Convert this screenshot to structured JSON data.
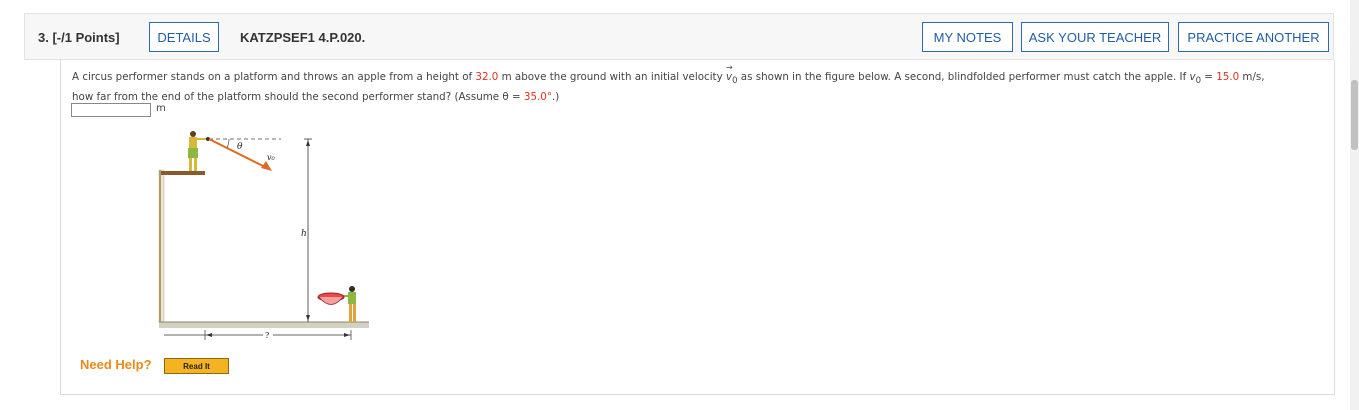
{
  "header": {
    "question_number": "3. [-/1 Points]",
    "details_label": "DETAILS",
    "problem_code": "KATZPSEF1 4.P.020.",
    "my_notes_label": "MY NOTES",
    "ask_teacher_label": "ASK YOUR TEACHER",
    "practice_label": "PRACTICE ANOTHER"
  },
  "question": {
    "t1": "A circus performer stands on a platform and throws an apple from a height of ",
    "height": "32.0",
    "t2": " m above the ground with an initial velocity ",
    "v0_symbol": "v",
    "v0_sub": "0",
    "t3": " as shown in the figure below. A second, blindfolded performer must catch the apple. If ",
    "v0_symbol2": "v",
    "v0_sub2": "0",
    "t4": " = ",
    "speed": "15.0",
    "t5": " m/s,",
    "t6": "how far from the end of the platform should the second performer stand? (Assume θ = ",
    "angle": "35.0°",
    "t7": ".)"
  },
  "answer": {
    "value": "",
    "unit": "m"
  },
  "figure": {
    "theta_label": "θ",
    "v0_label": "v₀",
    "h_label": "h",
    "distance_label": "?"
  },
  "help": {
    "label": "Need Help?",
    "read_it_label": "Read It"
  },
  "colors": {
    "accent": "#1f5da8",
    "given_value": "#e0301e",
    "help": "#e98b1b",
    "read_it_bg": "#f6b321"
  }
}
